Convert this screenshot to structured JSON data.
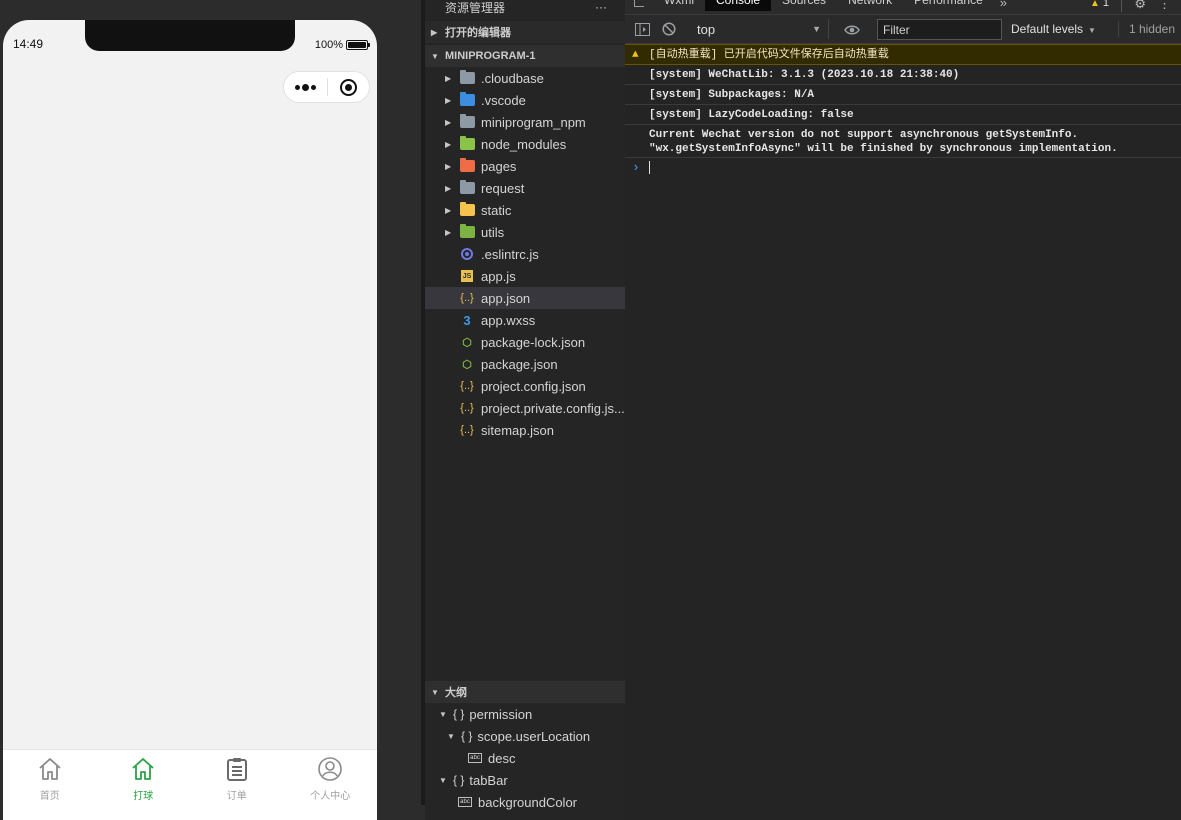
{
  "simulator": {
    "status_time": "14:49",
    "battery": "100%",
    "tabs": [
      {
        "label": "首页",
        "icon": "home-icon",
        "active": false
      },
      {
        "label": "打球",
        "icon": "home-icon",
        "active": true
      },
      {
        "label": "订单",
        "icon": "clipboard-icon",
        "active": false
      },
      {
        "label": "个人中心",
        "icon": "user-icon",
        "active": false
      }
    ]
  },
  "explorer": {
    "title": "资源管理器",
    "more": "···",
    "open_editors": "打开的编辑器",
    "project": "MINIPROGRAM-1",
    "folders": [
      {
        "name": ".cloudbase",
        "icon": "folder-icon",
        "color": "#8d9aa6"
      },
      {
        "name": ".vscode",
        "icon": "vscode-folder-icon",
        "color": "#3b8ee0"
      },
      {
        "name": "miniprogram_npm",
        "icon": "folder-icon",
        "color": "#8d9aa6"
      },
      {
        "name": "node_modules",
        "icon": "node-folder-icon",
        "color": "#8bc34a"
      },
      {
        "name": "pages",
        "icon": "pages-folder-icon",
        "color": "#ef6c46"
      },
      {
        "name": "request",
        "icon": "folder-icon",
        "color": "#8d9aa6"
      },
      {
        "name": "static",
        "icon": "static-folder-icon",
        "color": "#f4c34d"
      },
      {
        "name": "utils",
        "icon": "utils-folder-icon",
        "color": "#7cb342"
      }
    ],
    "files": [
      {
        "name": ".eslintrc.js",
        "icon": "eslint-icon",
        "glyph": ""
      },
      {
        "name": "app.js",
        "icon": "js-file-icon",
        "glyph": "JS"
      },
      {
        "name": "app.json",
        "icon": "json-file-icon",
        "glyph": "{..}",
        "selected": true
      },
      {
        "name": "app.wxss",
        "icon": "css-file-icon",
        "glyph": "3"
      },
      {
        "name": "package-lock.json",
        "icon": "node-file-icon",
        "glyph": "⬡"
      },
      {
        "name": "package.json",
        "icon": "node-file-icon",
        "glyph": "⬡"
      },
      {
        "name": "project.config.json",
        "icon": "json-file-icon",
        "glyph": "{..}"
      },
      {
        "name": "project.private.config.js...",
        "icon": "json-file-icon",
        "glyph": "{..}"
      },
      {
        "name": "sitemap.json",
        "icon": "json-file-icon",
        "glyph": "{..}"
      }
    ],
    "outline_title": "大纲",
    "outline": [
      {
        "name": "permission",
        "kind": "object",
        "depth": 0,
        "expanded": true
      },
      {
        "name": "scope.userLocation",
        "kind": "object",
        "depth": 1,
        "expanded": true
      },
      {
        "name": "desc",
        "kind": "string",
        "depth": 2
      },
      {
        "name": "tabBar",
        "kind": "object",
        "depth": 0,
        "expanded": true
      },
      {
        "name": "backgroundColor",
        "kind": "string",
        "depth": 1
      }
    ]
  },
  "devtools": {
    "tabs": [
      "Wxml",
      "Console",
      "Sources",
      "Network",
      "Performance"
    ],
    "active_tab": "Console",
    "more_tabs": "»",
    "warning_count": "1",
    "context": "top",
    "filter_placeholder": "Filter",
    "levels": "Default levels",
    "hidden": "1 hidden",
    "messages": [
      {
        "level": "warn",
        "text": "[自动热重载] 已开启代码文件保存后自动热重载"
      },
      {
        "level": "log",
        "text": "[system] WeChatLib: 3.1.3 (2023.10.18 21:38:40)"
      },
      {
        "level": "log",
        "text": "[system] Subpackages: N/A"
      },
      {
        "level": "log",
        "text": "[system] LazyCodeLoading: false"
      },
      {
        "level": "log",
        "lines": [
          "Current Wechat version do not support asynchronous getSystemInfo.",
          "\"wx.getSystemInfoAsync\" will be finished by synchronous implementation."
        ]
      }
    ]
  }
}
